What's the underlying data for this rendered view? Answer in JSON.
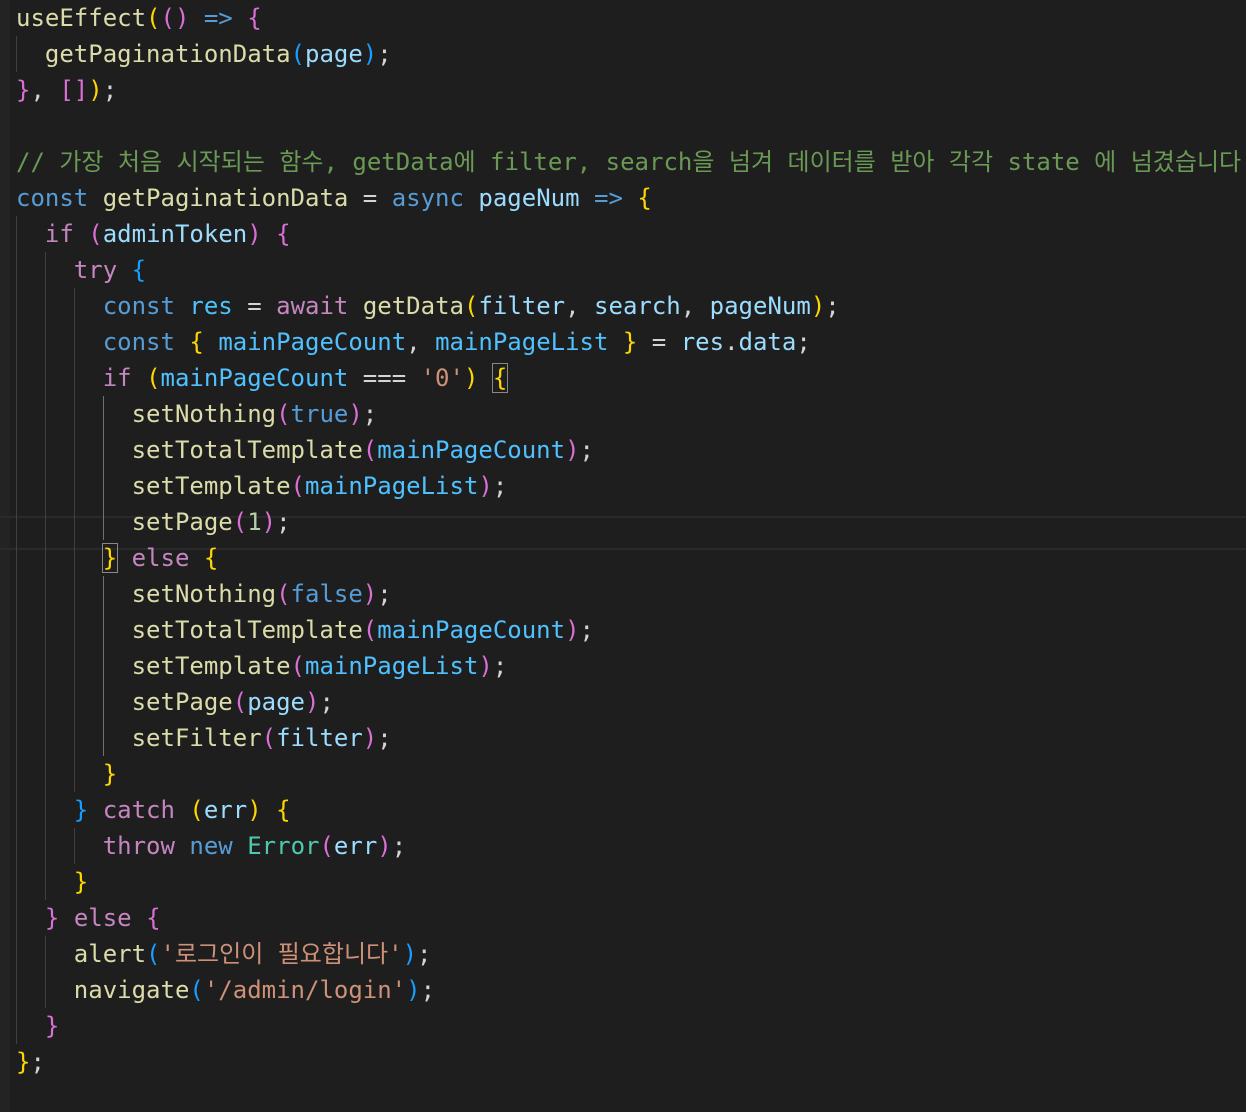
{
  "editor": {
    "language": "javascript",
    "theme_colors": {
      "background": "#1e1e1e",
      "default": "#d4d4d4",
      "variable": "#9cdcfe",
      "function": "#dcdcaa",
      "keyword": "#569cd6",
      "control": "#c586c0",
      "string": "#ce9178",
      "number": "#b5cea8",
      "comment": "#6a9955",
      "class": "#4ec9b0",
      "bracket_level_1": "#ffd700",
      "bracket_level_2": "#da70d6",
      "bracket_level_3": "#179fff"
    },
    "lines": [
      {
        "indent": 0,
        "tokens": [
          [
            "func",
            "useEffect"
          ],
          [
            "b1",
            "("
          ],
          [
            "b2",
            "()"
          ],
          [
            "default",
            " "
          ],
          [
            "keyword",
            "=>"
          ],
          [
            "default",
            " "
          ],
          [
            "b2",
            "{"
          ]
        ]
      },
      {
        "indent": 1,
        "tokens": [
          [
            "func",
            "getPaginationData"
          ],
          [
            "b3",
            "("
          ],
          [
            "var",
            "page"
          ],
          [
            "b3",
            ")"
          ],
          [
            "default",
            ";"
          ]
        ]
      },
      {
        "indent": 0,
        "tokens": [
          [
            "b2",
            "}"
          ],
          [
            "default",
            ", "
          ],
          [
            "b2",
            "[]"
          ],
          [
            "b1",
            ")"
          ],
          [
            "default",
            ";"
          ]
        ]
      },
      {
        "indent": 0,
        "tokens": []
      },
      {
        "indent": 0,
        "tokens": [
          [
            "comment",
            "// 가장 처음 시작되는 함수, getData에 filter, search을 넘겨 데이터를 받아 각각 state 에 넘겼습니다"
          ]
        ]
      },
      {
        "indent": 0,
        "tokens": [
          [
            "keyword",
            "const"
          ],
          [
            "default",
            " "
          ],
          [
            "func",
            "getPaginationData"
          ],
          [
            "default",
            " = "
          ],
          [
            "keyword",
            "async"
          ],
          [
            "default",
            " "
          ],
          [
            "var",
            "pageNum"
          ],
          [
            "default",
            " "
          ],
          [
            "keyword",
            "=>"
          ],
          [
            "default",
            " "
          ],
          [
            "b1",
            "{"
          ]
        ]
      },
      {
        "indent": 1,
        "tokens": [
          [
            "control",
            "if"
          ],
          [
            "default",
            " "
          ],
          [
            "b2",
            "("
          ],
          [
            "var",
            "adminToken"
          ],
          [
            "b2",
            ")"
          ],
          [
            "default",
            " "
          ],
          [
            "b2",
            "{"
          ]
        ]
      },
      {
        "indent": 2,
        "tokens": [
          [
            "control",
            "try"
          ],
          [
            "default",
            " "
          ],
          [
            "b3",
            "{"
          ]
        ]
      },
      {
        "indent": 3,
        "tokens": [
          [
            "keyword",
            "const"
          ],
          [
            "default",
            " "
          ],
          [
            "const",
            "res"
          ],
          [
            "default",
            " = "
          ],
          [
            "control",
            "await"
          ],
          [
            "default",
            " "
          ],
          [
            "func",
            "getData"
          ],
          [
            "b1",
            "("
          ],
          [
            "var",
            "filter"
          ],
          [
            "default",
            ", "
          ],
          [
            "var",
            "search"
          ],
          [
            "default",
            ", "
          ],
          [
            "var",
            "pageNum"
          ],
          [
            "b1",
            ")"
          ],
          [
            "default",
            ";"
          ]
        ]
      },
      {
        "indent": 3,
        "tokens": [
          [
            "keyword",
            "const"
          ],
          [
            "default",
            " "
          ],
          [
            "b1",
            "{"
          ],
          [
            "default",
            " "
          ],
          [
            "const",
            "mainPageCount"
          ],
          [
            "default",
            ", "
          ],
          [
            "const",
            "mainPageList"
          ],
          [
            "default",
            " "
          ],
          [
            "b1",
            "}"
          ],
          [
            "default",
            " = "
          ],
          [
            "var",
            "res"
          ],
          [
            "default",
            "."
          ],
          [
            "var",
            "data"
          ],
          [
            "default",
            ";"
          ]
        ]
      },
      {
        "indent": 3,
        "tokens": [
          [
            "control",
            "if"
          ],
          [
            "default",
            " "
          ],
          [
            "b1",
            "("
          ],
          [
            "const",
            "mainPageCount"
          ],
          [
            "default",
            " === "
          ],
          [
            "string",
            "'0'"
          ],
          [
            "b1",
            ")"
          ],
          [
            "default",
            " "
          ],
          [
            "b1m",
            "{"
          ]
        ]
      },
      {
        "indent": 4,
        "tokens": [
          [
            "func",
            "setNothing"
          ],
          [
            "b2",
            "("
          ],
          [
            "keyword",
            "true"
          ],
          [
            "b2",
            ")"
          ],
          [
            "default",
            ";"
          ]
        ]
      },
      {
        "indent": 4,
        "tokens": [
          [
            "func",
            "setTotalTemplate"
          ],
          [
            "b2",
            "("
          ],
          [
            "const",
            "mainPageCount"
          ],
          [
            "b2",
            ")"
          ],
          [
            "default",
            ";"
          ]
        ]
      },
      {
        "indent": 4,
        "tokens": [
          [
            "func",
            "setTemplate"
          ],
          [
            "b2",
            "("
          ],
          [
            "const",
            "mainPageList"
          ],
          [
            "b2",
            ")"
          ],
          [
            "default",
            ";"
          ]
        ]
      },
      {
        "indent": 4,
        "tokens": [
          [
            "func",
            "setPage"
          ],
          [
            "b2",
            "("
          ],
          [
            "number",
            "1"
          ],
          [
            "b2",
            ")"
          ],
          [
            "default",
            ";"
          ]
        ]
      },
      {
        "indent": 3,
        "tokens": [
          [
            "b1m",
            "}"
          ],
          [
            "default",
            " "
          ],
          [
            "control",
            "else"
          ],
          [
            "default",
            " "
          ],
          [
            "b1",
            "{"
          ]
        ]
      },
      {
        "indent": 4,
        "tokens": [
          [
            "func",
            "setNothing"
          ],
          [
            "b2",
            "("
          ],
          [
            "keyword",
            "false"
          ],
          [
            "b2",
            ")"
          ],
          [
            "default",
            ";"
          ]
        ]
      },
      {
        "indent": 4,
        "tokens": [
          [
            "func",
            "setTotalTemplate"
          ],
          [
            "b2",
            "("
          ],
          [
            "const",
            "mainPageCount"
          ],
          [
            "b2",
            ")"
          ],
          [
            "default",
            ";"
          ]
        ]
      },
      {
        "indent": 4,
        "tokens": [
          [
            "func",
            "setTemplate"
          ],
          [
            "b2",
            "("
          ],
          [
            "const",
            "mainPageList"
          ],
          [
            "b2",
            ")"
          ],
          [
            "default",
            ";"
          ]
        ]
      },
      {
        "indent": 4,
        "tokens": [
          [
            "func",
            "setPage"
          ],
          [
            "b2",
            "("
          ],
          [
            "var",
            "page"
          ],
          [
            "b2",
            ")"
          ],
          [
            "default",
            ";"
          ]
        ]
      },
      {
        "indent": 4,
        "tokens": [
          [
            "func",
            "setFilter"
          ],
          [
            "b2",
            "("
          ],
          [
            "var",
            "filter"
          ],
          [
            "b2",
            ")"
          ],
          [
            "default",
            ";"
          ]
        ]
      },
      {
        "indent": 3,
        "tokens": [
          [
            "b1",
            "}"
          ]
        ]
      },
      {
        "indent": 2,
        "tokens": [
          [
            "b3",
            "}"
          ],
          [
            "default",
            " "
          ],
          [
            "control",
            "catch"
          ],
          [
            "default",
            " "
          ],
          [
            "b1",
            "("
          ],
          [
            "var",
            "err"
          ],
          [
            "b1",
            ")"
          ],
          [
            "default",
            " "
          ],
          [
            "b1",
            "{"
          ]
        ]
      },
      {
        "indent": 3,
        "tokens": [
          [
            "control",
            "throw"
          ],
          [
            "default",
            " "
          ],
          [
            "keyword",
            "new"
          ],
          [
            "default",
            " "
          ],
          [
            "class",
            "Error"
          ],
          [
            "b2",
            "("
          ],
          [
            "var",
            "err"
          ],
          [
            "b2",
            ")"
          ],
          [
            "default",
            ";"
          ]
        ]
      },
      {
        "indent": 2,
        "tokens": [
          [
            "b1",
            "}"
          ]
        ]
      },
      {
        "indent": 1,
        "tokens": [
          [
            "b2",
            "}"
          ],
          [
            "default",
            " "
          ],
          [
            "control",
            "else"
          ],
          [
            "default",
            " "
          ],
          [
            "b2",
            "{"
          ]
        ]
      },
      {
        "indent": 2,
        "tokens": [
          [
            "func",
            "alert"
          ],
          [
            "b3",
            "("
          ],
          [
            "string",
            "'로그인이 필요합니다'"
          ],
          [
            "b3",
            ")"
          ],
          [
            "default",
            ";"
          ]
        ]
      },
      {
        "indent": 2,
        "tokens": [
          [
            "func",
            "navigate"
          ],
          [
            "b3",
            "("
          ],
          [
            "string",
            "'/admin/login'"
          ],
          [
            "b3",
            ")"
          ],
          [
            "default",
            ";"
          ]
        ]
      },
      {
        "indent": 1,
        "tokens": [
          [
            "b2",
            "}"
          ]
        ]
      },
      {
        "indent": 0,
        "tokens": [
          [
            "b1",
            "}"
          ],
          [
            "default",
            ";"
          ]
        ]
      }
    ]
  }
}
